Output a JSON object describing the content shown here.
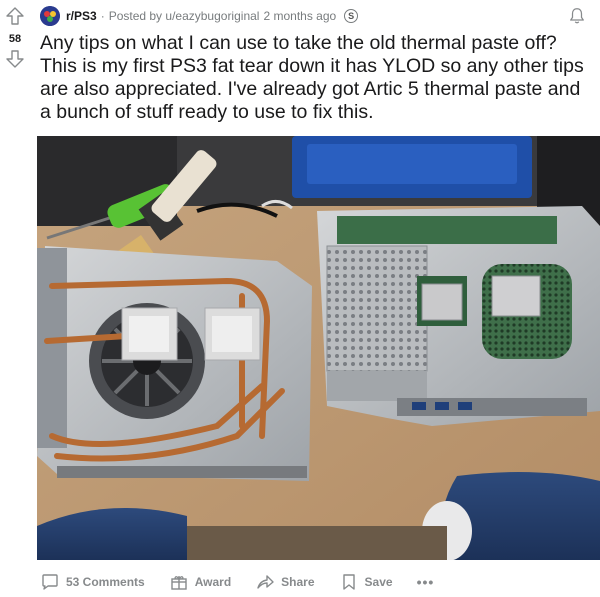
{
  "post": {
    "subreddit": "r/PS3",
    "separator": "·",
    "posted_by": "Posted by u/eazybugoriginal",
    "time_ago": "2 months ago",
    "award_glyph": "S",
    "votes": "58",
    "title": "Any tips on what I can use to take the old thermal paste off? This is my first PS3 fat tear down it has YLOD so any other tips are also appreciated. I've already got Artic 5 thermal paste and a bunch of stuff ready to use to fix this."
  },
  "actions": {
    "comments": "53 Comments",
    "award": "Award",
    "share": "Share",
    "save": "Save",
    "more": "•••"
  },
  "colors": {
    "text": "#1a1a1b",
    "muted": "#787c7e",
    "action": "#878a8c",
    "upvote_outline": "#878a8c",
    "subreddit_avatar": "#2a3b8f"
  },
  "icons": {
    "upvote": "arrow-up-icon",
    "downvote": "arrow-down-icon",
    "notify": "bell-icon",
    "comments": "comment-icon",
    "award": "gift-icon",
    "share": "share-arrow-icon",
    "save": "bookmark-icon"
  }
}
